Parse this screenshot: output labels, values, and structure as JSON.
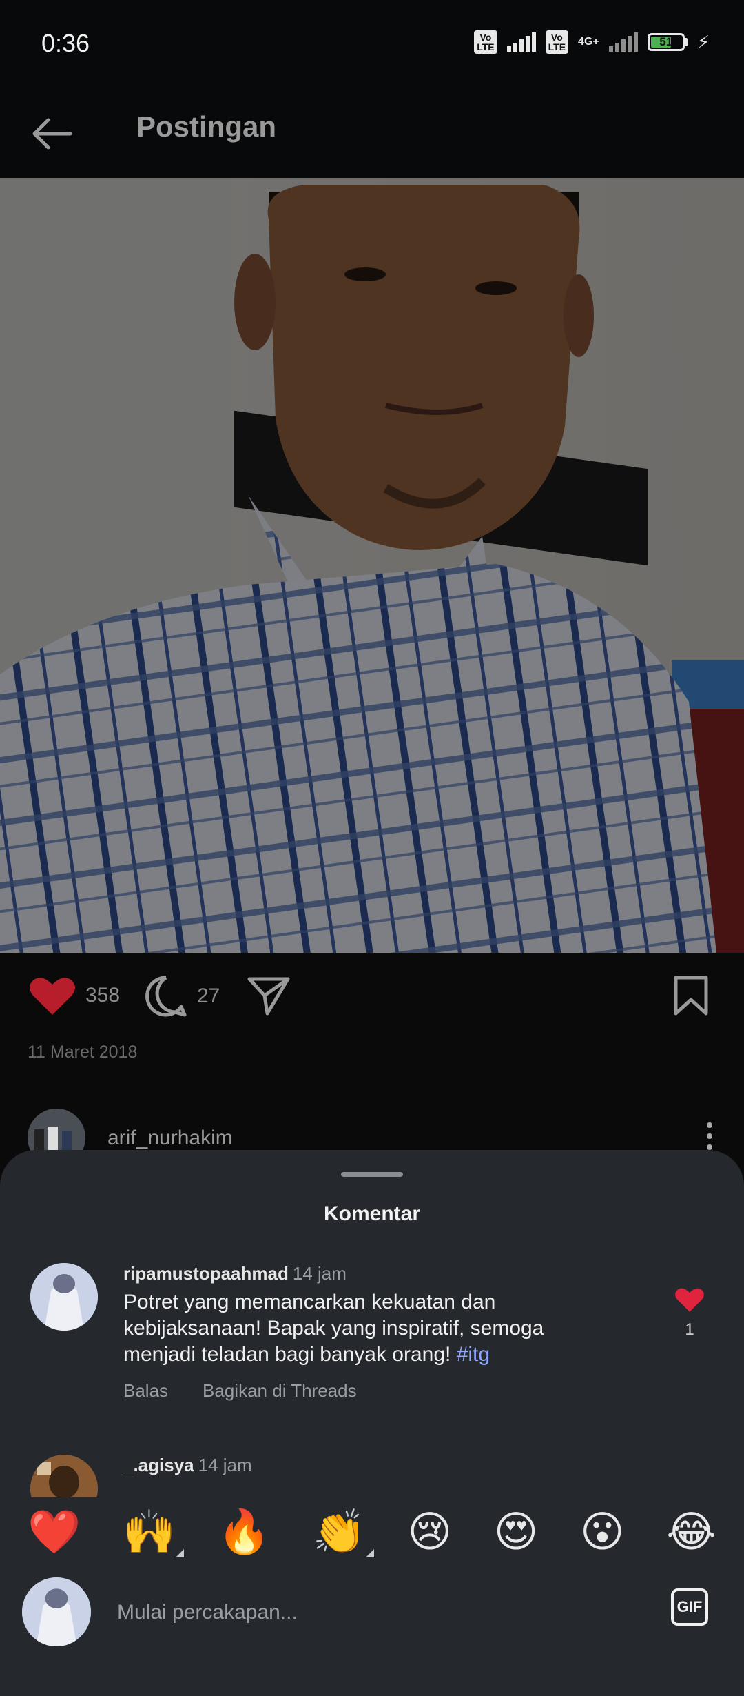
{
  "status_bar": {
    "time": "0:36",
    "volte_1": "Vo LTE",
    "volte_2": "Vo LTE",
    "network": "4G+",
    "battery": "51"
  },
  "header": {
    "title": "Postingan",
    "back_icon": "arrow-left-icon"
  },
  "post": {
    "likes": "358",
    "comments": "27",
    "date": "11 Maret 2018",
    "author": "arif_nurhakim",
    "like_color": "#c8102e"
  },
  "sheet": {
    "title": "Komentar",
    "comments": [
      {
        "user": "ripamustopaahmad",
        "time": "14 jam",
        "text": "Potret yang memancarkan kekuatan dan kebijaksanaan!  Bapak yang inspiratif, semoga menjadi teladan bagi banyak orang! ",
        "tag": "#itg",
        "reply": "Balas",
        "share": "Bagikan di Threads",
        "likes": "1"
      },
      {
        "user": "_.agisya",
        "time": "14 jam"
      }
    ]
  },
  "emoji_bar": {
    "items": [
      "❤️",
      "🙌",
      "🔥",
      "👏",
      "😢",
      "😍",
      "😮",
      "😂"
    ]
  },
  "composer": {
    "placeholder": "Mulai percakapan...",
    "gif_label": "GIF"
  }
}
